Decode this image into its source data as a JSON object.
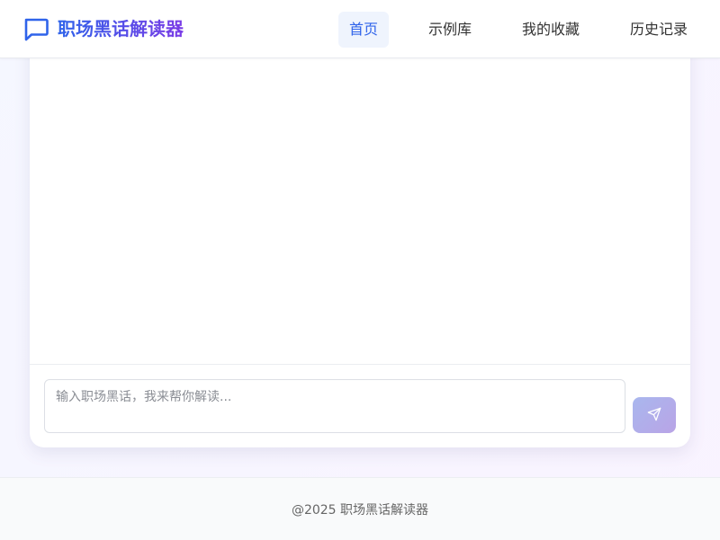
{
  "header": {
    "logo_icon": "chat-bubble-icon",
    "app_title": "职场黑话解读器",
    "nav": [
      {
        "label": "首页",
        "active": true
      },
      {
        "label": "示例库",
        "active": false
      },
      {
        "label": "我的收藏",
        "active": false
      },
      {
        "label": "历史记录",
        "active": false
      }
    ]
  },
  "chat": {
    "input_placeholder": "输入职场黑话，我来帮你解读...",
    "send_icon": "send-icon"
  },
  "footer": {
    "copyright": "@2025 职场黑话解读器"
  },
  "colors": {
    "brand_blue": "#2f63ea",
    "brand_purple": "#7a3be6",
    "nav_active_bg": "#eff4fd"
  }
}
